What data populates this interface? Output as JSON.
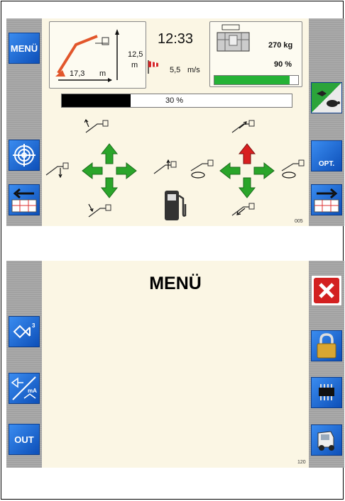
{
  "screen1": {
    "menu_button": "MENÜ",
    "time": "12:33",
    "boom": {
      "height_value": "12,5",
      "height_unit": "m",
      "reach_value": "17,3",
      "reach_unit": "m"
    },
    "wind": {
      "value": "5,5",
      "unit": "m/s"
    },
    "basket": {
      "load": "270 kg",
      "load_percent": "90 %",
      "load_fraction": 0.9
    },
    "progress": {
      "label": "30 %",
      "fraction": 0.3
    },
    "opt_label": "OPT.",
    "screen_code": "005",
    "colors": {
      "up_arrow_left": "#2aa52a",
      "up_arrow_right": "#d81f1f",
      "arrow": "#2aa52a",
      "load_bar": "#25b236"
    }
  },
  "screen2": {
    "title": "MENÜ",
    "out_button": "OUT",
    "screen_code": "120",
    "icons": [
      "sensor-icon",
      "calibration-icon",
      "close-icon",
      "lock-icon",
      "chip-icon",
      "truck-icon"
    ]
  }
}
